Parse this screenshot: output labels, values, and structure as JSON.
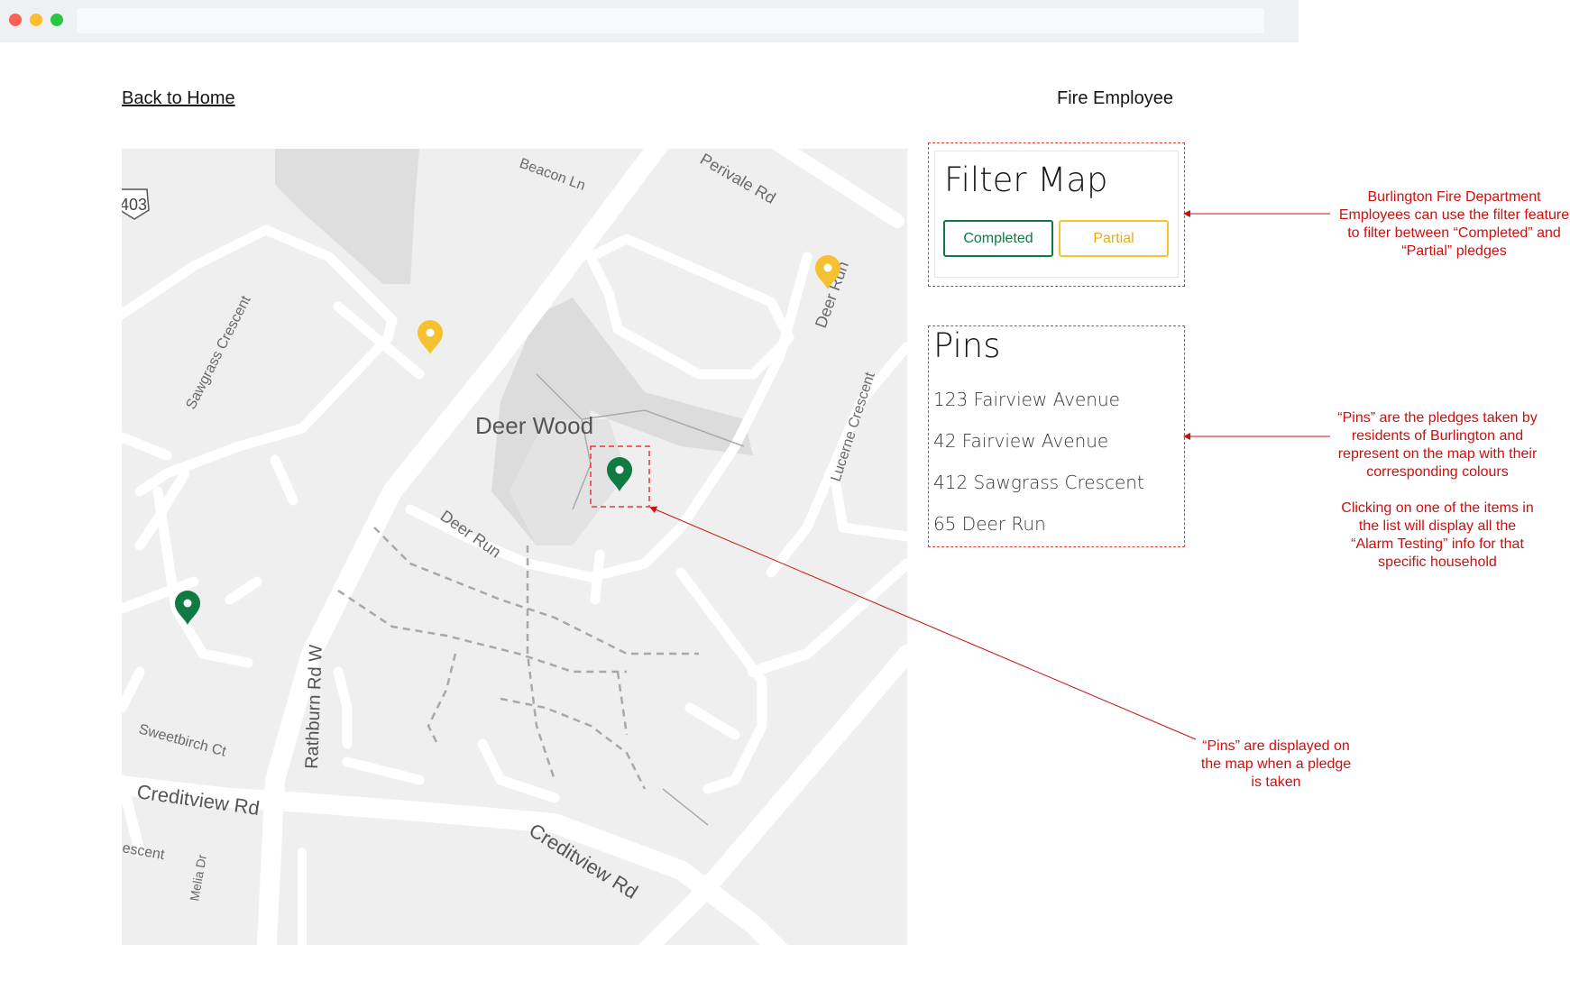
{
  "header": {
    "back_link": "Back to Home",
    "user_role": "Fire Employee"
  },
  "map": {
    "labels": {
      "highway": "403",
      "beacon": "Beacon Ln",
      "perivale": "Perivale Rd",
      "sawgrass": "Sawgrass Crescent",
      "deer_run_top": "Deer Run",
      "lucerne": "Lucerne Crescent",
      "deer_wood": "Deer Wood",
      "deer_run_mid": "Deer Run",
      "rathburn": "Rathburn Rd W",
      "sweetbirch": "Sweetbirch Ct",
      "creditview_left": "Creditview Rd",
      "creditview_right": "Creditview Rd",
      "crescent": "escent",
      "melia": "Melia Dr"
    },
    "pins": [
      {
        "status": "partial",
        "color": "#f6c12f"
      },
      {
        "status": "partial",
        "color": "#f6c12f"
      },
      {
        "status": "completed",
        "color": "#0f7a42"
      },
      {
        "status": "completed",
        "color": "#0f7a42"
      }
    ]
  },
  "filter": {
    "title": "Filter Map",
    "completed_label": "Completed",
    "partial_label": "Partial"
  },
  "pins_panel": {
    "title": "Pins",
    "items": [
      "123 Fairview Avenue",
      "42 Fairview Avenue",
      "412 Sawgrass Crescent",
      "65 Deer Run"
    ]
  },
  "annotations": {
    "filter_note": [
      "Burlington Fire Department",
      "Employees can use the filter feature",
      "to filter between “Completed” and",
      "“Partial” pledges"
    ],
    "pins_note": [
      "“Pins” are the pledges taken by",
      "residents of Burlington and",
      "represent on the map with their",
      "corresponding colours"
    ],
    "click_note": [
      "Clicking on one of the items in",
      "the list will display all the",
      "“Alarm Testing” info for that",
      "specific household"
    ],
    "map_note": [
      "“Pins” are displayed on",
      "the map when a pledge",
      "is taken"
    ]
  },
  "colors": {
    "completed": "#0f7a42",
    "partial": "#f6c12f",
    "annotation": "#cc1010"
  }
}
